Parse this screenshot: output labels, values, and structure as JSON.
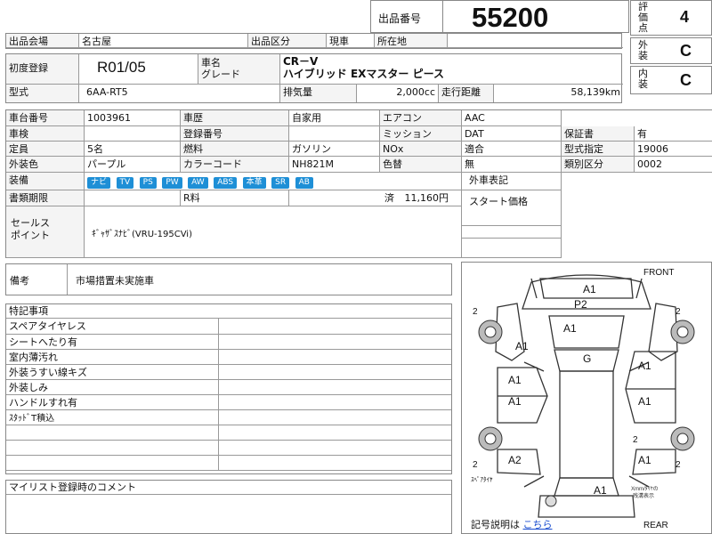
{
  "header": {
    "lot_label": "出品番号",
    "lot_number": "55200",
    "eval_label": "評価点",
    "eval_value": "4",
    "exterior_label": "外装",
    "exterior_value": "C",
    "interior_label": "内装",
    "interior_value": "C"
  },
  "row_venue": {
    "venue_label": "出品会場",
    "venue_value": "名古屋",
    "category_label": "出品区分",
    "category_value": "現車",
    "location_label": "所在地",
    "location_value": ""
  },
  "vehicle": {
    "first_reg_label": "初度登録",
    "first_reg_value": "R01/05",
    "name_label": "車名\nグレード",
    "car_name": "CR－V",
    "grade": "ハイブリッド EXマスター ピース",
    "model_label": "型式",
    "model_value": "6AA-RT5",
    "displacement_label": "排気量",
    "displacement_value": "2,000cc",
    "mileage_label": "走行距離",
    "mileage_value": "58,139km"
  },
  "specs": {
    "chassis_label": "車台番号",
    "chassis_value": "1003961",
    "history_label": "車歴",
    "history_value": "自家用",
    "ac_label": "エアコン",
    "ac_value": "AAC",
    "inspection_label": "車検",
    "inspection_value": "",
    "regno_label": "登録番号",
    "regno_value": "",
    "mission_label": "ミッション",
    "mission_value": "DAT",
    "warranty_label": "保証書",
    "warranty_value": "有",
    "capacity_label": "定員",
    "capacity_value": "5名",
    "fuel_label": "燃料",
    "fuel_value": "ガソリン",
    "nox_label": "NOx",
    "nox_value": "適合",
    "typecert_label": "型式指定",
    "typecert_value": "19006",
    "color_label": "外装色",
    "color_value": "パープル",
    "colorcode_label": "カラーコード",
    "colorcode_value": "NH821M",
    "repaint_label": "色替",
    "repaint_value": "無",
    "class_label": "類別区分",
    "class_value": "0002",
    "equip_label": "装備",
    "equipment": [
      "ナビ",
      "TV",
      "PS",
      "PW",
      "AW",
      "ABS",
      "本革",
      "SR",
      "AB"
    ],
    "exterior_note_label": "外車表記",
    "docs_label": "書類期限",
    "docs_r": "R料",
    "docs_paid": "済",
    "docs_amount": "11,160円",
    "start_price_label": "スタート価格",
    "sales_label": "セールス\nポイント",
    "sales_value": "ｷﾞｬｻﾞｽﾅﾋﾞ(VRU-195CVi)",
    "tag_color": "#1e8fd6"
  },
  "remarks": {
    "label": "備考",
    "value": "市場措置未実施車"
  },
  "special_notes": {
    "label": "特記事項",
    "items": [
      "スペアタイヤレス",
      "シートへたり有",
      "室内薄汚れ",
      "外装うすい線キズ",
      "外装しみ",
      "ハンドルすれ有",
      "ｽﾀｯﾄﾞT積込",
      "",
      "",
      "",
      ""
    ]
  },
  "comment": {
    "label": "マイリスト登録時のコメント"
  },
  "diagram": {
    "front": "FRONT",
    "rear": "REAR",
    "spare_tire": "ｽﾍﾟｱﾀｲﾔ",
    "note": "Xmm/ﾀｲﾔの\n残溝表示",
    "legend_label": "記号説明は",
    "legend_link": "こちら",
    "marks": {
      "hood": "A1",
      "front_bumper": "P2",
      "windshield": "A1",
      "roof": "G",
      "fl_fender": "A1",
      "fl_door": "A1",
      "rl_door": "A1",
      "rl_quarter": "A2",
      "fr_door": "A1",
      "rr_door": "A1",
      "rr_quarter": "A1",
      "rear_bumper": "A1",
      "tire_fl": "2",
      "tire_fr": "2",
      "tire_rl": "2",
      "tire_rr": "2",
      "tire_mid_r": "2",
      "tire_rear_r": "2"
    }
  }
}
